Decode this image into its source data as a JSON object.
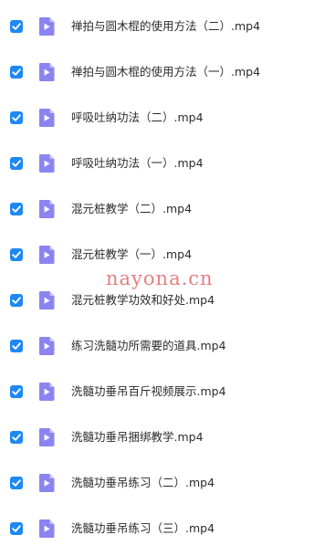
{
  "files": [
    {
      "name": "禅拍与圆木棍的使用方法（二）.mp4",
      "checked": true,
      "icon": "video-file-icon"
    },
    {
      "name": "禅拍与圆木棍的使用方法（一）.mp4",
      "checked": true,
      "icon": "video-file-icon"
    },
    {
      "name": "呼吸吐纳功法（二）.mp4",
      "checked": true,
      "icon": "video-file-icon"
    },
    {
      "name": "呼吸吐纳功法（一）.mp4",
      "checked": true,
      "icon": "video-file-icon"
    },
    {
      "name": "混元桩教学（二）.mp4",
      "checked": true,
      "icon": "video-file-icon"
    },
    {
      "name": "混元桩教学（一）.mp4",
      "checked": true,
      "icon": "video-file-icon"
    },
    {
      "name": "混元桩教学功效和好处.mp4",
      "checked": true,
      "icon": "video-file-icon"
    },
    {
      "name": "练习洗髓功所需要的道具.mp4",
      "checked": true,
      "icon": "video-file-icon"
    },
    {
      "name": "洗髓功垂吊百斤视频展示.mp4",
      "checked": true,
      "icon": "video-file-icon"
    },
    {
      "name": "洗髓功垂吊捆绑教学.mp4",
      "checked": true,
      "icon": "video-file-icon"
    },
    {
      "name": "洗髓功垂吊练习（二）.mp4",
      "checked": true,
      "icon": "video-file-icon"
    },
    {
      "name": "洗髓功垂吊练习（三）.mp4",
      "checked": true,
      "icon": "video-file-icon"
    }
  ],
  "watermark": "nayona.cn",
  "colors": {
    "checkbox": "#1e88f5",
    "icon": "#8b84f0",
    "text": "#2b2b2b",
    "watermark": "#e05a5a"
  }
}
